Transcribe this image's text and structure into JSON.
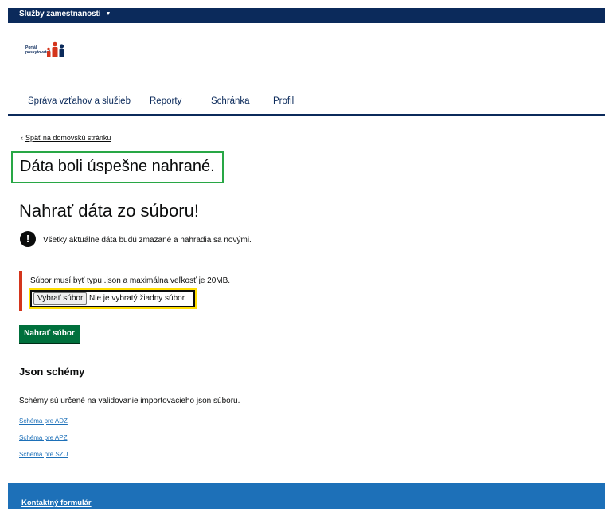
{
  "topbar": {
    "service_label": "Služby zamestnanosti",
    "caret": "▼"
  },
  "logo": {
    "line1": "Portál",
    "line2": "poskytovateľ"
  },
  "nav": {
    "items": [
      {
        "label": "Správa vzťahov a služieb"
      },
      {
        "label": "Reporty"
      },
      {
        "label": "Schránka"
      },
      {
        "label": "Profil"
      }
    ]
  },
  "back_link": {
    "chevron": "‹",
    "label": "Späť na domovskú stránku"
  },
  "success_message": "Dáta boli úspešne nahrané.",
  "page_title": "Nahrať dáta zo súboru!",
  "warning": {
    "icon": "!",
    "text": "Všetky aktuálne dáta budú zmazané a nahradia sa novými."
  },
  "upload": {
    "hint": "Súbor musí byť typu .json a maximálna veľkosť je 20MB.",
    "file_button": "Vybrať súbor",
    "file_status": "Nie je vybratý žiadny súbor",
    "submit_label": "Nahrať súbor"
  },
  "schemas": {
    "heading": "Json schémy",
    "description": "Schémy sú určené na validovanie importovacieho json súboru.",
    "links": [
      {
        "label": "Schéma pre ADZ"
      },
      {
        "label": "Schéma pre APZ"
      },
      {
        "label": "Schéma pre SZU"
      }
    ]
  },
  "footer": {
    "contact_link": "Kontaktný formulár"
  },
  "colors": {
    "header_bg": "#0b2a5b",
    "success_border": "#28a745",
    "error_border": "#d4351c",
    "focus": "#ffdd00",
    "submit_bg": "#00703c",
    "link": "#1d70b8",
    "footer_bg": "#1d70b8",
    "logo_red": "#d4351c",
    "logo_navy": "#0b2a5b"
  }
}
